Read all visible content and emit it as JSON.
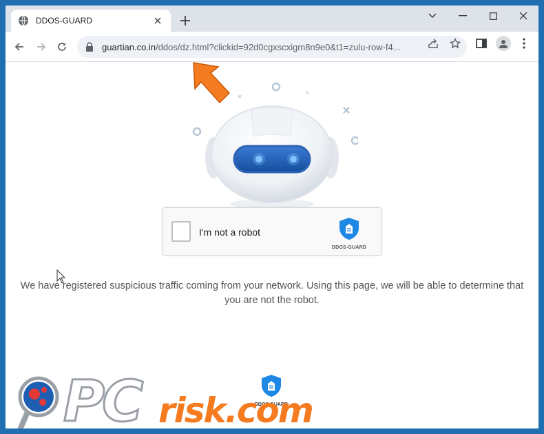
{
  "browser": {
    "tab_title": "DDOS-GUARD",
    "url_domain": "guartian.co.in",
    "url_path": "/ddos/dz.html?clickid=92d0cgxscxigm8n9e0&t1=zulu-row-f4..."
  },
  "captcha": {
    "label": "I'm not a robot",
    "brand": "DDOS-GUARD"
  },
  "page": {
    "message": "We have registered suspicious traffic coming from your network. Using this page, we will be able to determine that you are not the robot.",
    "footer_brand": "DDOS-GUARD"
  },
  "watermark": {
    "pc": "PC",
    "risk": "risk.com"
  },
  "colors": {
    "frame": "#1f6fb2",
    "tabstrip": "#dee3ea",
    "accent_arrow": "#f47b20",
    "shield": "#1e88e5"
  }
}
